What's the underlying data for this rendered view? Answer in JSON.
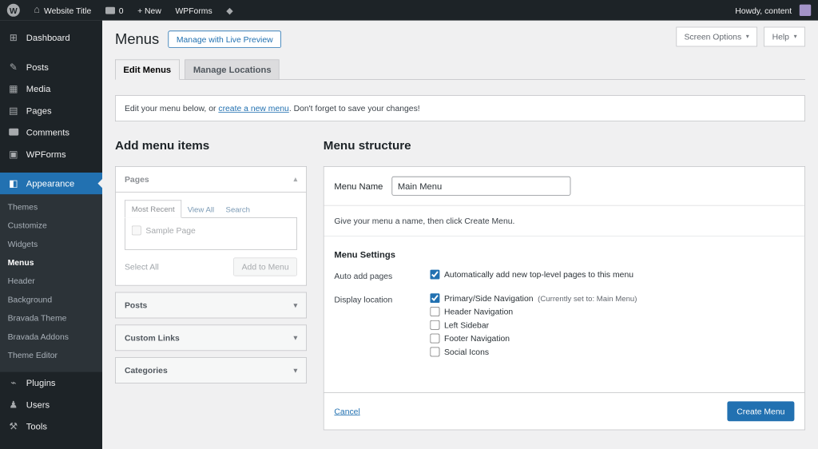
{
  "colors": {
    "accent": "#2271b1",
    "admin_bar_bg": "#1d2327",
    "sidebar_bg": "#1d2327",
    "content_bg": "#f0f0f1"
  },
  "glyphs": {
    "home": "⌂",
    "gem": "◆",
    "caret": "▾",
    "chevron_up": "▴",
    "chevron_down": "▾"
  },
  "admin_bar": {
    "wp_logo": "W",
    "site_name": "Website Title",
    "comments_count": "0",
    "new_label": "+ New",
    "wpforms_label": "WPForms",
    "howdy": "Howdy, content"
  },
  "sidebar": {
    "items": [
      {
        "glyph": "⊞",
        "label": "Dashboard"
      },
      {
        "glyph": "✎",
        "label": "Posts"
      },
      {
        "glyph": "▦",
        "label": "Media"
      },
      {
        "glyph": "▤",
        "label": "Pages"
      },
      {
        "glyph": "",
        "label": "Comments"
      },
      {
        "glyph": "▣",
        "label": "WPForms"
      },
      {
        "glyph": "◧",
        "label": "Appearance"
      },
      {
        "glyph": "⌁",
        "label": "Plugins"
      },
      {
        "glyph": "♟",
        "label": "Users"
      },
      {
        "glyph": "⚒",
        "label": "Tools"
      }
    ],
    "appearance_submenu": [
      {
        "label": "Themes"
      },
      {
        "label": "Customize"
      },
      {
        "label": "Widgets"
      },
      {
        "label": "Menus"
      },
      {
        "label": "Header"
      },
      {
        "label": "Background"
      },
      {
        "label": "Bravada Theme"
      },
      {
        "label": "Bravada Addons"
      },
      {
        "label": "Theme Editor"
      }
    ]
  },
  "header": {
    "title": "Menus",
    "live_preview_button": "Manage with Live Preview",
    "screen_options": "Screen Options",
    "help": "Help"
  },
  "tabs": {
    "edit_menus": "Edit Menus",
    "manage_locations": "Manage Locations"
  },
  "notice": {
    "before_link": "Edit your menu below, or ",
    "link": "create a new menu",
    "after_link": ". Don't forget to save your changes!"
  },
  "add_menu_items": {
    "heading": "Add menu items",
    "pages_panel": {
      "title": "Pages",
      "tabs": [
        "Most Recent",
        "View All",
        "Search"
      ],
      "items": [
        {
          "label": "Sample Page"
        }
      ],
      "select_all": "Select All",
      "add_to_menu": "Add to Menu"
    },
    "collapsed_panels": [
      {
        "title": "Posts"
      },
      {
        "title": "Custom Links"
      },
      {
        "title": "Categories"
      }
    ]
  },
  "menu_structure": {
    "heading": "Menu structure",
    "menu_name_label": "Menu Name",
    "menu_name_value": "Main Menu",
    "hint": "Give your menu a name, then click Create Menu.",
    "settings_heading": "Menu Settings",
    "auto_add": {
      "label": "Auto add pages",
      "checkbox_label": "Automatically add new top-level pages to this menu",
      "checked": true
    },
    "display_location": {
      "label": "Display location",
      "options": [
        {
          "label": "Primary/Side Navigation",
          "note": "(Currently set to: Main Menu)",
          "checked": true
        },
        {
          "label": "Header Navigation",
          "checked": false
        },
        {
          "label": "Left Sidebar",
          "checked": false
        },
        {
          "label": "Footer Navigation",
          "checked": false
        },
        {
          "label": "Social Icons",
          "checked": false
        }
      ]
    },
    "footer": {
      "cancel": "Cancel",
      "create": "Create Menu"
    }
  }
}
